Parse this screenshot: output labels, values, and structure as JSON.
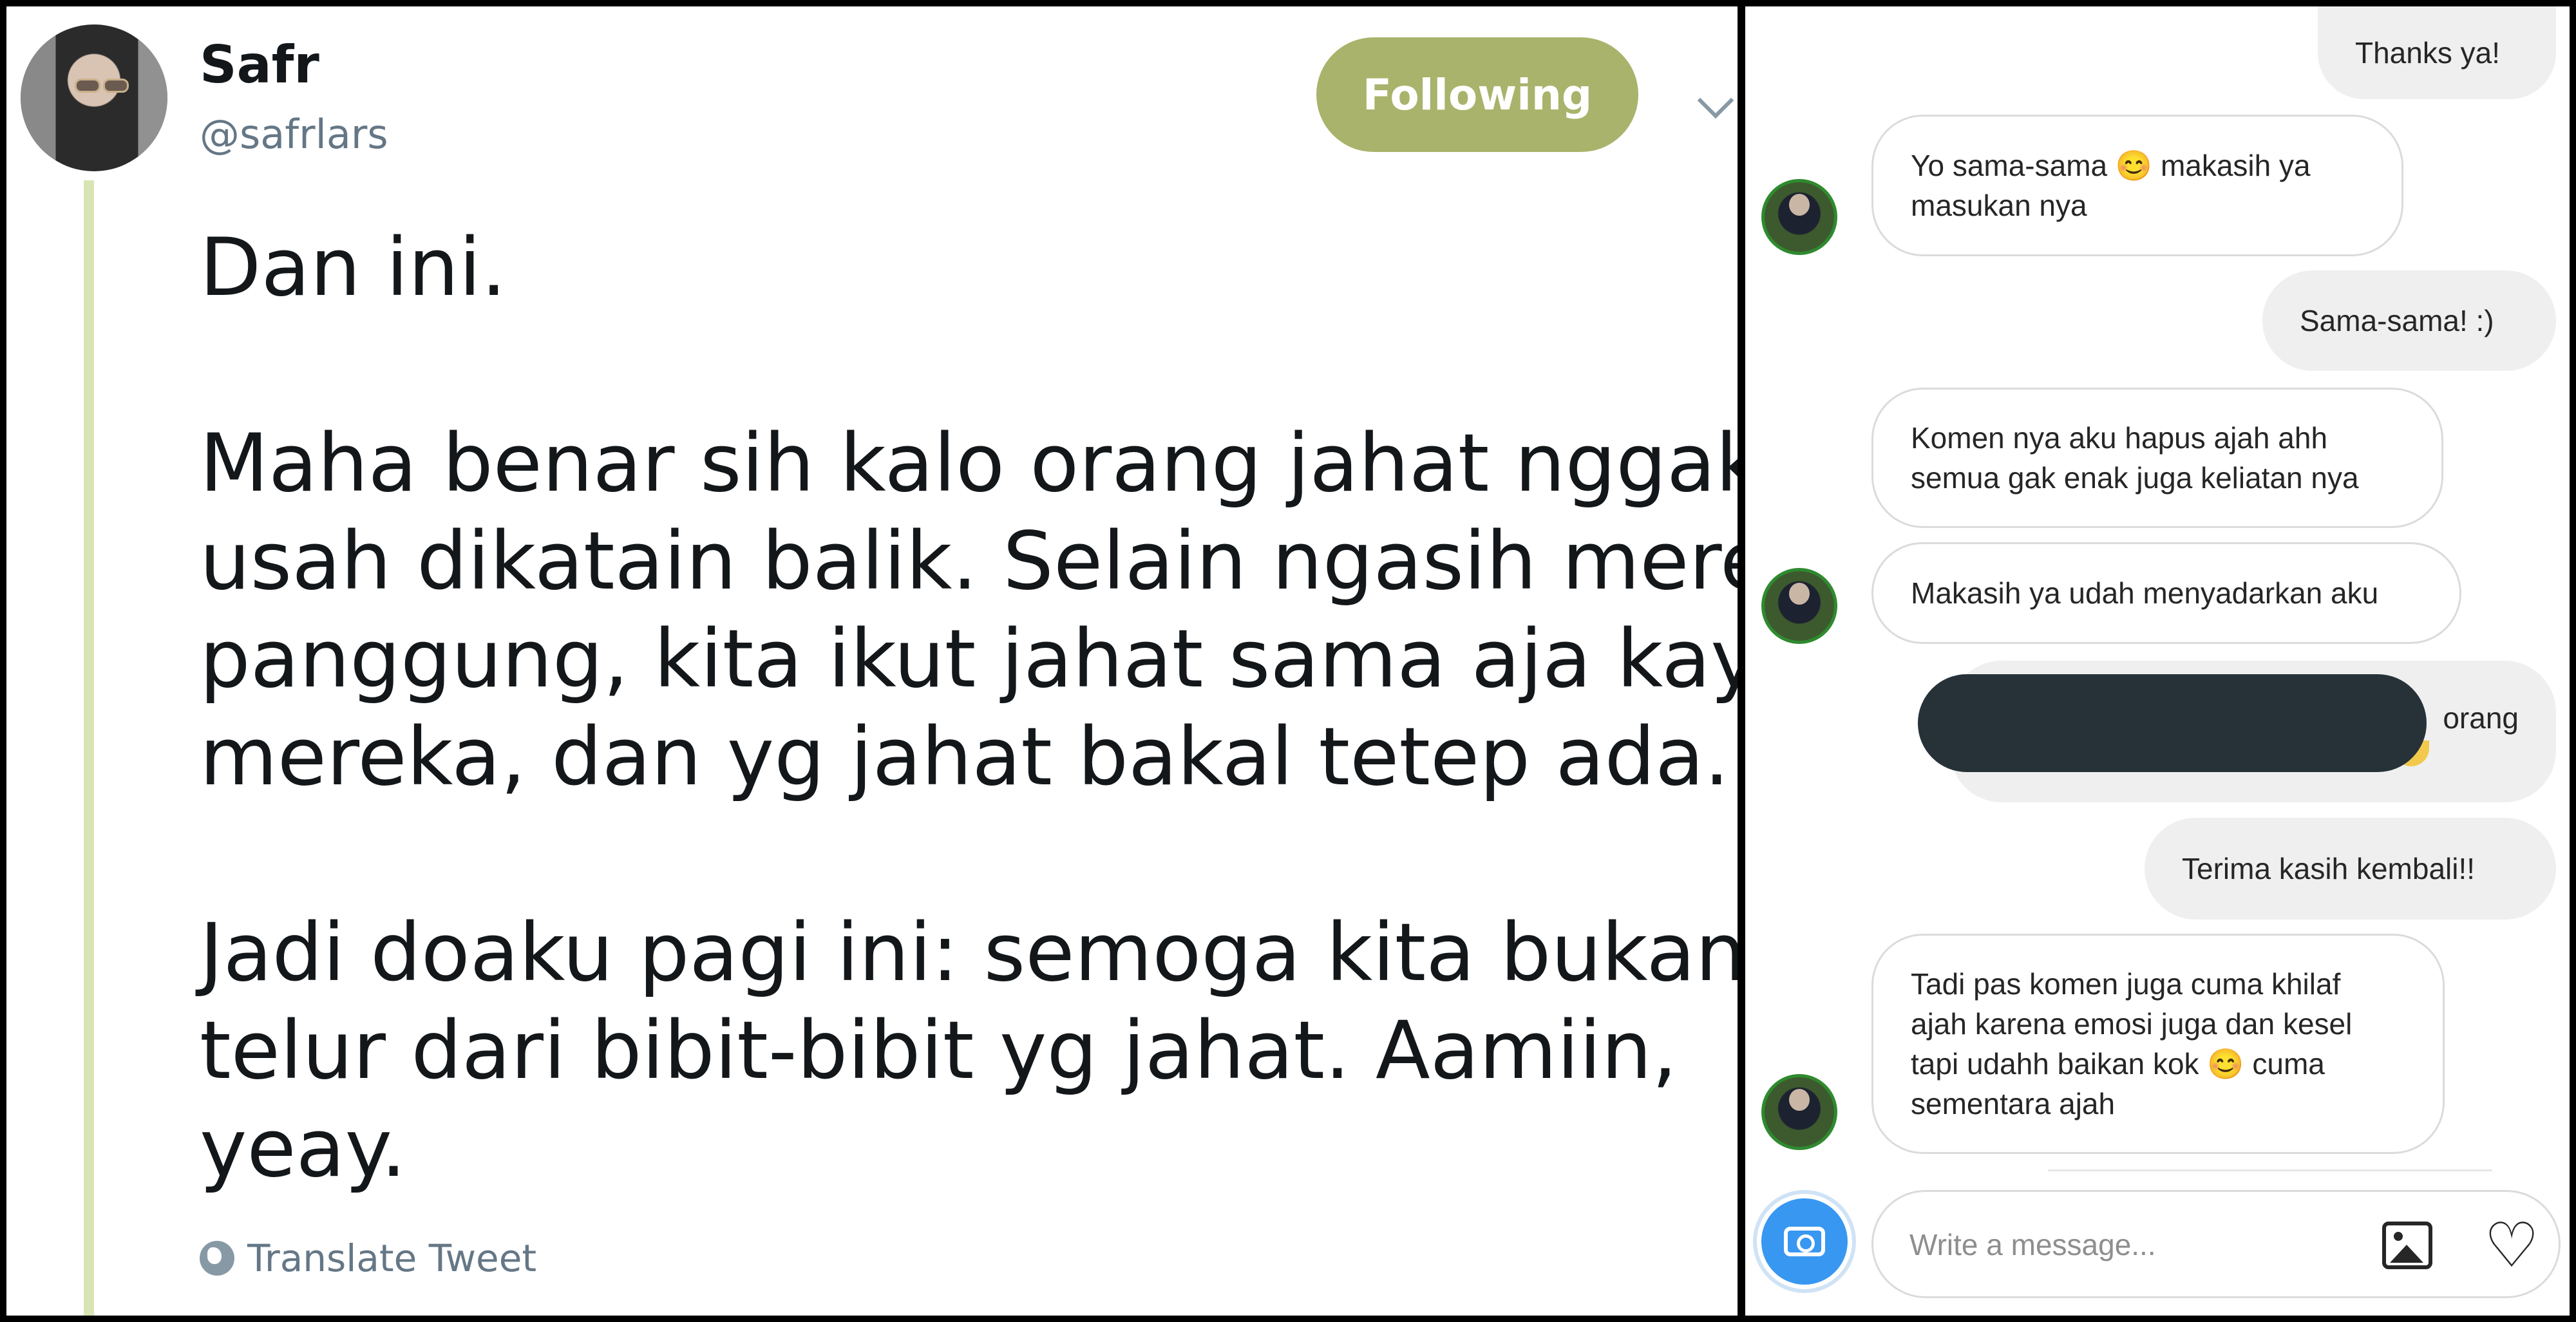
{
  "tweet": {
    "author_name": "Safr",
    "author_handle": "@safrlars",
    "follow_button_label": "Following",
    "paragraphs": [
      [
        "Dan ini."
      ],
      [
        "Maha benar sih kalo orang jahat nggak",
        "usah dikatain balik. Selain ngasih mereka",
        "panggung, kita ikut jahat sama aja kaya",
        "mereka, dan yg jahat bakal tetep ada."
      ],
      [
        "Jadi doaku pagi ini: semoga kita bukan",
        "telur dari bibit-bibit yg jahat. Aamiin,",
        "yeay."
      ]
    ],
    "translate_label": "Translate Tweet",
    "icons": {
      "menu": "chevron-down-icon",
      "translate": "globe-icon"
    },
    "colors": {
      "follow_button": "#a9b36b",
      "thread_line": "#d9e4b5"
    }
  },
  "chat": {
    "messages": [
      {
        "from": "me",
        "text": "Thanks ya!"
      },
      {
        "from": "them",
        "text": "Yo sama-sama 😊 makasih ya\nmasukan nya"
      },
      {
        "from": "me",
        "text": "Sama-sama! :)"
      },
      {
        "from": "them",
        "text": "Komen nya aku hapus ajah ahh\nsemua gak enak juga keliatan nya"
      },
      {
        "from": "them",
        "text": "Makasih ya udah menyadarkan aku"
      },
      {
        "from": "me",
        "text": "orang",
        "redacted": true
      },
      {
        "from": "me",
        "text": "Terima kasih kembali!!"
      },
      {
        "from": "them",
        "text": "Tadi pas komen juga cuma khilaf\najah karena emosi juga dan kesel\ntapi udahh baikan kok 😊 cuma\nsementara ajah"
      }
    ],
    "composer": {
      "placeholder": "Write a message...",
      "icons": [
        "camera-icon",
        "gallery-icon",
        "heart-icon"
      ]
    },
    "colors": {
      "camera_button": "#3897f0",
      "my_bubble": "#efefef",
      "their_bubble_border": "#dbdbdb"
    }
  }
}
